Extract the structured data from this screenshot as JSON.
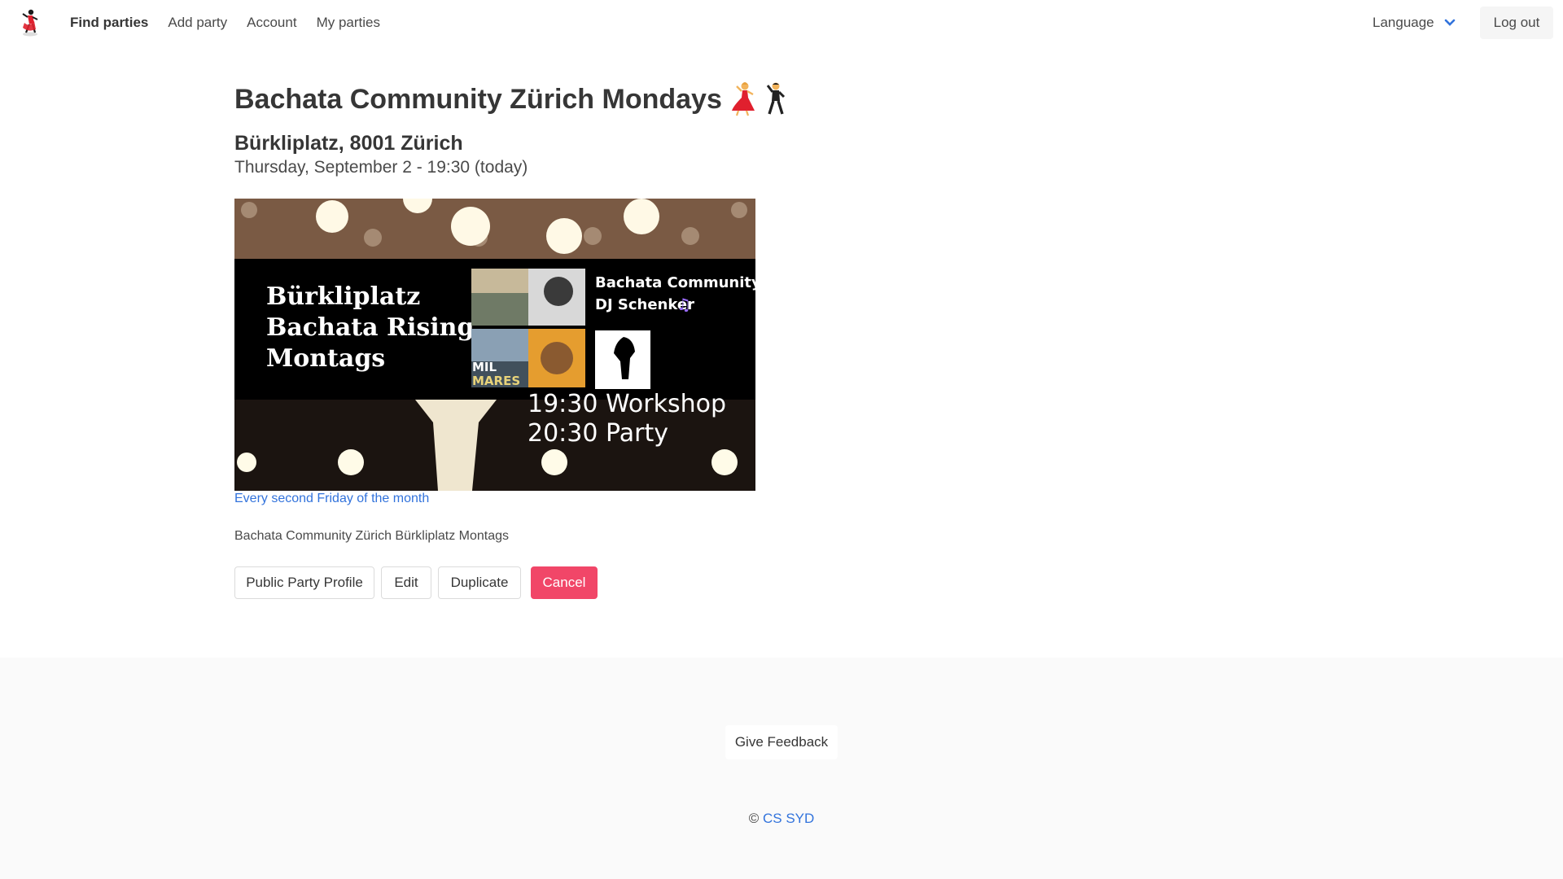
{
  "nav": {
    "logo_icon": "dancer-logo-icon",
    "links": [
      {
        "label": "Find parties",
        "active": true
      },
      {
        "label": "Add party"
      },
      {
        "label": "Account"
      },
      {
        "label": "My parties"
      }
    ],
    "language_label": "Language",
    "logout_label": "Log out"
  },
  "party": {
    "title": "Bachata Community Zürich Mondays",
    "title_emoji": [
      "dancing-woman-icon",
      "dancing-man-icon"
    ],
    "address": "Bürkliplatz, 8001 Zürich",
    "datetime": "Thursday, September 2 - 19:30 (today)",
    "poster": {
      "heading_lines": [
        "Bürkliplatz",
        "Bachata Rising",
        "Montags"
      ],
      "side_lines": [
        "Bachata Community",
        "DJ Schenker"
      ],
      "album_text": [
        "MIL",
        "MARES"
      ],
      "schedule_lines": [
        "19:30 Workshop",
        "20:30 Party"
      ]
    },
    "recurrence": "Every second Friday of the month",
    "description": "Bachata Community Zürich Bürkliplatz Montags"
  },
  "actions": {
    "public_profile": "Public Party Profile",
    "edit": "Edit",
    "duplicate": "Duplicate",
    "cancel": "Cancel"
  },
  "footer": {
    "feedback_label": "Give Feedback",
    "copyright_symbol": "©",
    "copyright_link": "CS SYD"
  },
  "colors": {
    "link": "#3273dc",
    "danger": "#f14668",
    "footer_bg": "#fafafa"
  }
}
